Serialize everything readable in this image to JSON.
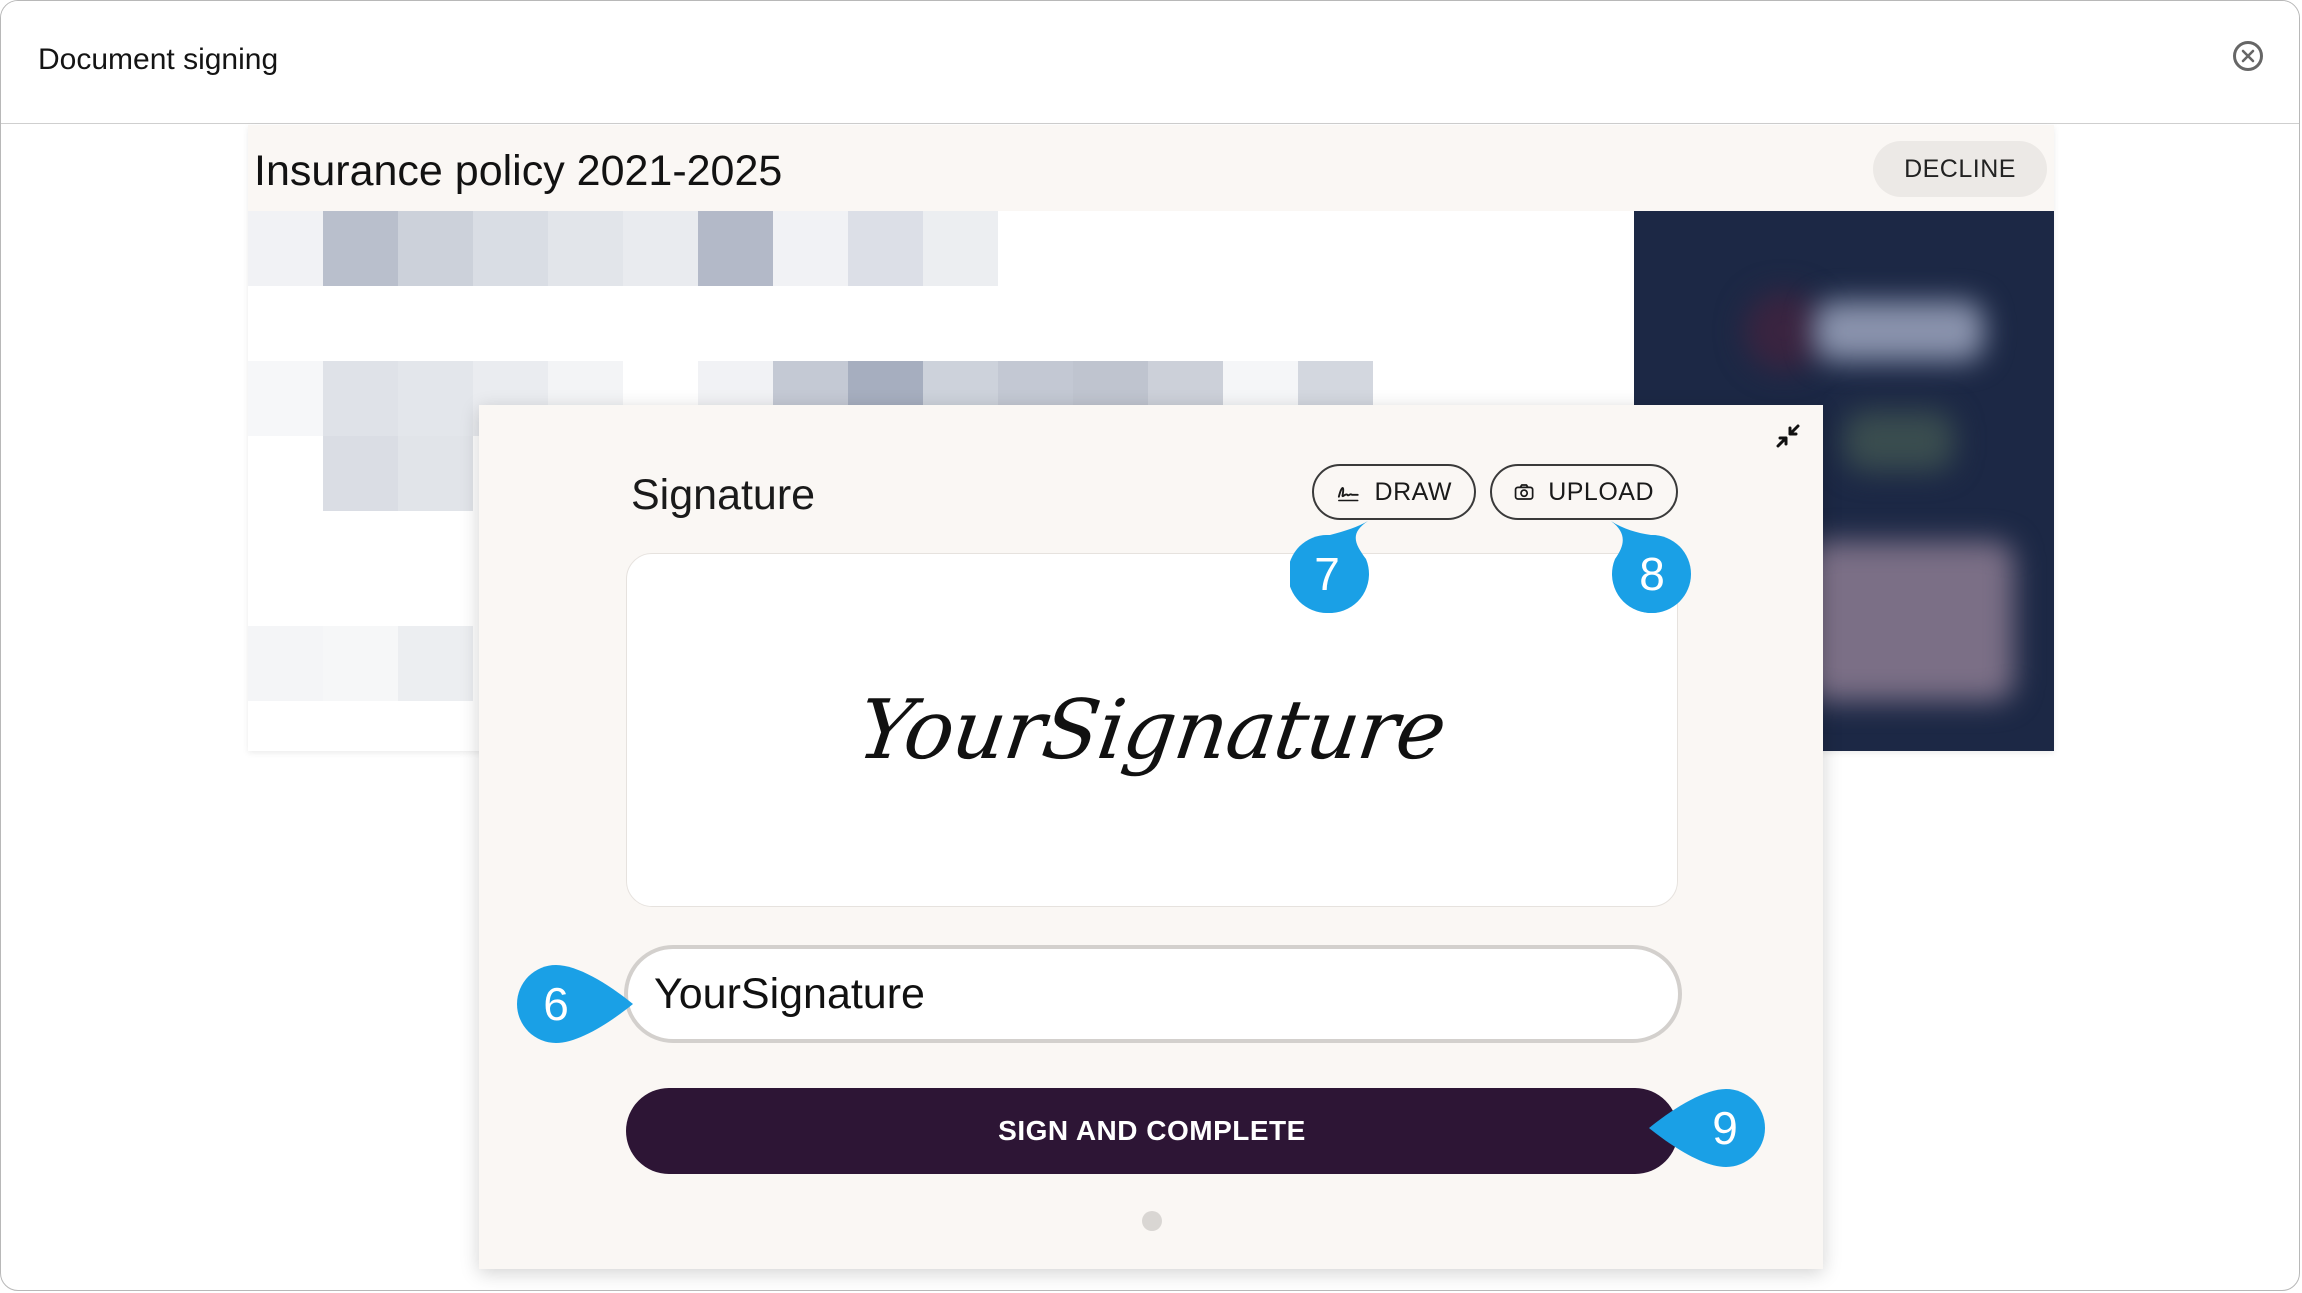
{
  "window": {
    "title": "Document signing",
    "close_icon": "close-circle-icon"
  },
  "document": {
    "title": "Insurance policy 2021-2025",
    "decline_label": "DECLINE"
  },
  "signature_modal": {
    "heading": "Signature",
    "collapse_icon": "collapse-arrows-icon",
    "draw_label": "DRAW",
    "draw_icon": "signature-pen-icon",
    "upload_label": "UPLOAD",
    "upload_icon": "camera-icon",
    "preview_text": "YourSignature",
    "name_input_value": "YourSignature",
    "submit_label": "SIGN AND COMPLETE"
  },
  "callouts": [
    {
      "number": "6",
      "target": "signature-name-input"
    },
    {
      "number": "7",
      "target": "draw-button"
    },
    {
      "number": "8",
      "target": "upload-button"
    },
    {
      "number": "9",
      "target": "sign-and-complete-button"
    }
  ],
  "colors": {
    "accent_callout": "#1aa0e6",
    "primary_button": "#2d1535",
    "document_panel": "#1c2845",
    "modal_background": "#faf7f4"
  }
}
